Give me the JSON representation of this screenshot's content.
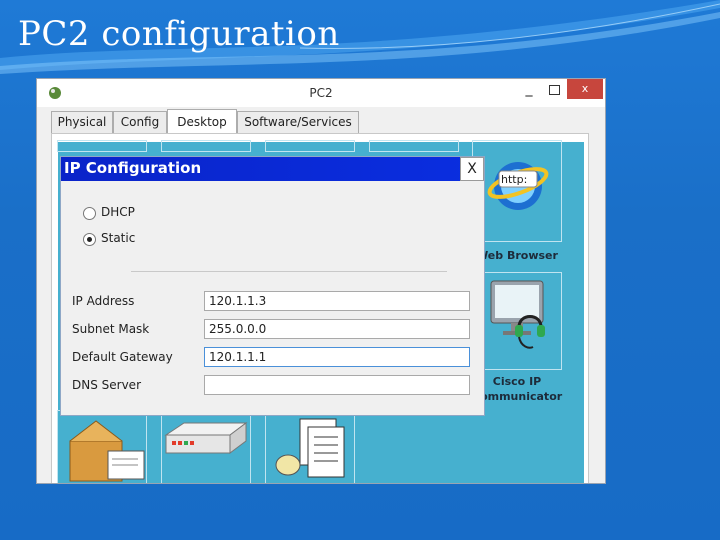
{
  "slide": {
    "title": "PC2 configuration"
  },
  "window": {
    "title": "PC2",
    "minimize_label": "_",
    "close_label": "x",
    "tabs": [
      {
        "label": "Physical",
        "active": false
      },
      {
        "label": "Config",
        "active": false
      },
      {
        "label": "Desktop",
        "active": true
      },
      {
        "label": "Software/Services",
        "active": false
      }
    ]
  },
  "desktop": {
    "apps": [
      {
        "label": "Web Browser",
        "icon": "web-browser-icon"
      },
      {
        "label": "Cisco IP Communicator",
        "icon": "ip-communicator-icon"
      }
    ],
    "bottom_icons": [
      "email-icon",
      "pppoe-dialer-icon",
      "text-editor-icon"
    ]
  },
  "ip_config": {
    "title": "IP Configuration",
    "close_label": "X",
    "modes": [
      {
        "label": "DHCP",
        "selected": false
      },
      {
        "label": "Static",
        "selected": true
      }
    ],
    "fields": [
      {
        "label": "IP Address",
        "value": "120.1.1.3"
      },
      {
        "label": "Subnet Mask",
        "value": "255.0.0.0"
      },
      {
        "label": "Default Gateway",
        "value": "120.1.1.1"
      },
      {
        "label": "DNS Server",
        "value": ""
      }
    ]
  },
  "colors": {
    "slide_background": "#1a6fc8",
    "desktop_background": "#46b0cf",
    "dialog_title_bar": "#0a24c9",
    "window_close": "#c7463d"
  }
}
